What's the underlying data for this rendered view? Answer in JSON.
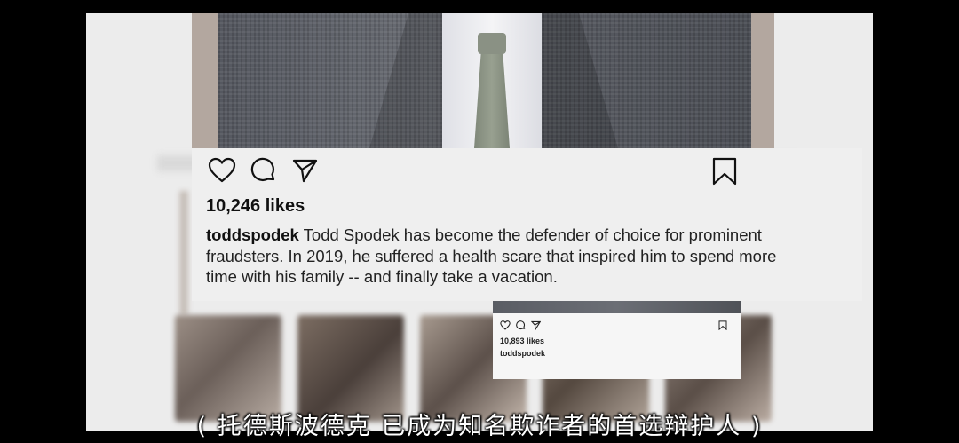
{
  "post": {
    "likes": "10,246 likes",
    "username": "toddspodek",
    "caption": "Todd Spodek has become the defender of choice for prominent fraudsters. In 2019, he suffered a health scare that inspired him to spend more time with his family -- and finally take a vacation.",
    "icons": [
      "heart-icon",
      "comment-icon",
      "share-icon",
      "bookmark-icon"
    ]
  },
  "mini_post": {
    "likes": "10,893 likes",
    "username": "toddspodek"
  },
  "subtitle": "( 托德斯波德克 已成为知名欺诈者的首选辩护人 )"
}
